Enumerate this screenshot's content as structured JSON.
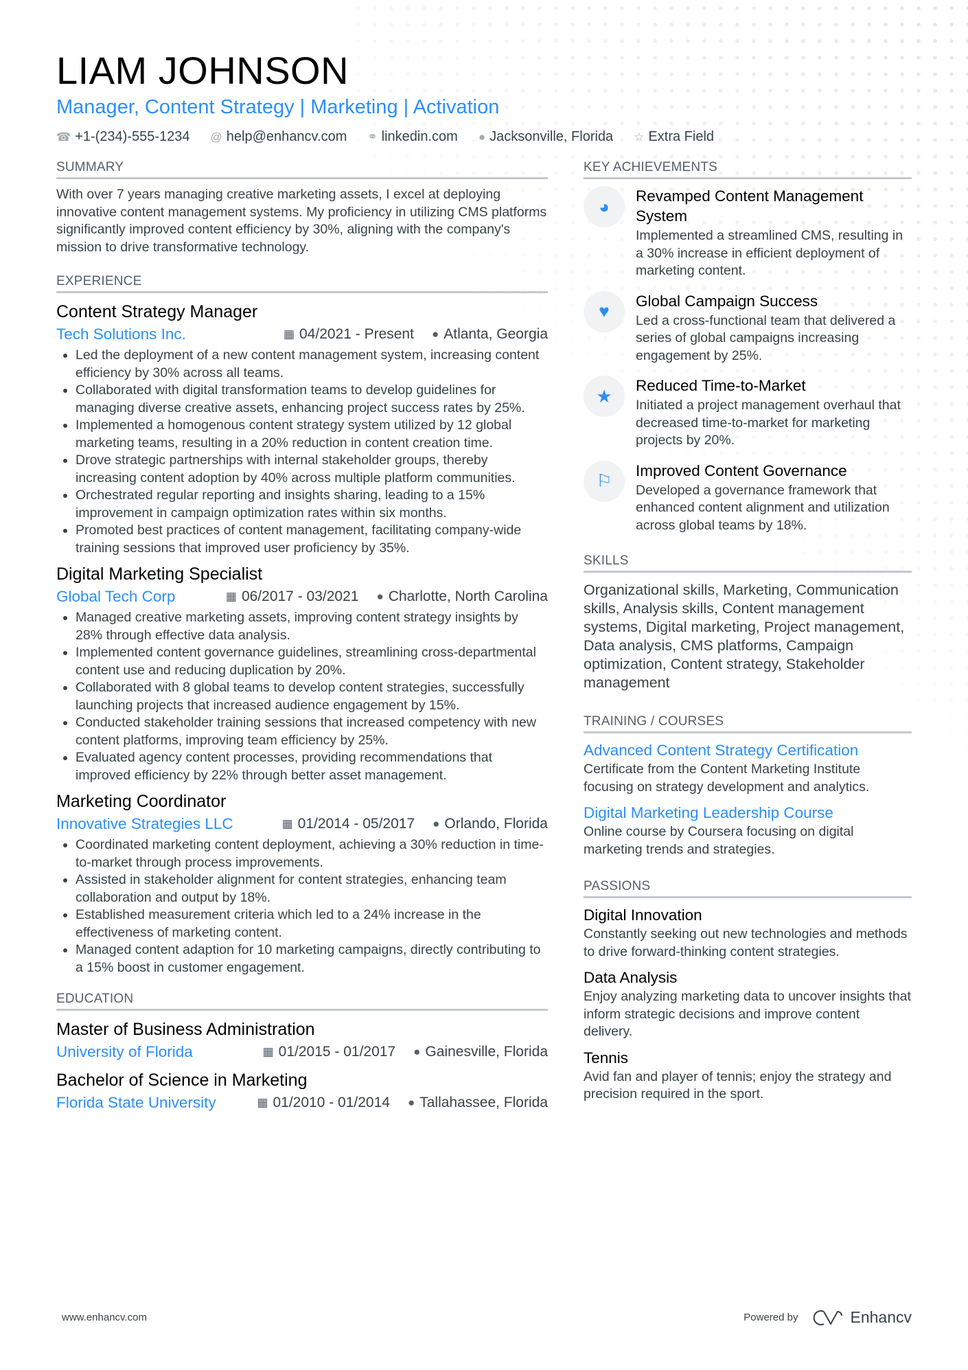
{
  "header": {
    "name": "LIAM JOHNSON",
    "title": "Manager, Content Strategy | Marketing | Activation",
    "contacts": [
      {
        "icon": "phone-icon",
        "glyph": "☎",
        "text": "+1-(234)-555-1234"
      },
      {
        "icon": "at-icon",
        "glyph": "@",
        "text": "help@enhancv.com"
      },
      {
        "icon": "link-icon",
        "glyph": "⚭",
        "text": "linkedin.com"
      },
      {
        "icon": "location-icon",
        "glyph": "●",
        "text": "Jacksonville, Florida"
      },
      {
        "icon": "star-icon",
        "glyph": "☆",
        "text": "Extra Field"
      }
    ]
  },
  "summary": {
    "heading": "SUMMARY",
    "text": "With over 7 years managing creative marketing assets, I excel at deploying innovative content management systems. My proficiency in utilizing CMS platforms significantly improved content efficiency by 30%, aligning with the company's mission to drive transformative technology."
  },
  "experience": {
    "heading": "EXPERIENCE",
    "jobs": [
      {
        "title": "Content Strategy Manager",
        "company": "Tech Solutions Inc.",
        "dates": "04/2021 - Present",
        "location": "Atlanta, Georgia",
        "bullets": [
          "Led the deployment of a new content management system, increasing content efficiency by 30% across all teams.",
          "Collaborated with digital transformation teams to develop guidelines for managing diverse creative assets, enhancing project success rates by 25%.",
          "Implemented a homogenous content strategy system utilized by 12 global marketing teams, resulting in a 20% reduction in content creation time.",
          "Drove strategic partnerships with internal stakeholder groups, thereby increasing content adoption by 40% across multiple platform communities.",
          "Orchestrated regular reporting and insights sharing, leading to a 15% improvement in campaign optimization rates within six months.",
          "Promoted best practices of content management, facilitating company-wide training sessions that improved user proficiency by 35%."
        ]
      },
      {
        "title": "Digital Marketing Specialist",
        "company": "Global Tech Corp",
        "dates": "06/2017 - 03/2021",
        "location": "Charlotte, North Carolina",
        "bullets": [
          "Managed creative marketing assets, improving content strategy insights by 28% through effective data analysis.",
          "Implemented content governance guidelines, streamlining cross-departmental content use and reducing duplication by 20%.",
          "Collaborated with 8 global teams to develop content strategies, successfully launching projects that increased audience engagement by 15%.",
          "Conducted stakeholder training sessions that increased competency with new content platforms, improving team efficiency by 25%.",
          "Evaluated agency content processes, providing recommendations that improved efficiency by 22% through better asset management."
        ]
      },
      {
        "title": "Marketing Coordinator",
        "company": "Innovative Strategies LLC",
        "dates": "01/2014 - 05/2017",
        "location": "Orlando, Florida",
        "bullets": [
          "Coordinated marketing content deployment, achieving a 30% reduction in time-to-market through process improvements.",
          "Assisted in stakeholder alignment for content strategies, enhancing team collaboration and output by 18%.",
          "Established measurement criteria which led to a 24% increase in the effectiveness of marketing content.",
          "Managed content adaption for 10 marketing campaigns, directly contributing to a 15% boost in customer engagement."
        ]
      }
    ]
  },
  "education": {
    "heading": "EDUCATION",
    "items": [
      {
        "degree": "Master of Business Administration",
        "school": "University of Florida",
        "dates": "01/2015 - 01/2017",
        "location": "Gainesville, Florida"
      },
      {
        "degree": "Bachelor of Science in Marketing",
        "school": "Florida State University",
        "dates": "01/2010 - 01/2014",
        "location": "Tallahassee, Florida"
      }
    ]
  },
  "achievements": {
    "heading": "KEY ACHIEVEMENTS",
    "items": [
      {
        "icon": "brain-head-icon",
        "glyph": "◕",
        "title": "Revamped Content Management System",
        "desc": "Implemented a streamlined CMS, resulting in a 30% increase in efficient deployment of marketing content."
      },
      {
        "icon": "heart-icon",
        "glyph": "♥",
        "title": "Global Campaign Success",
        "desc": "Led a cross-functional team that delivered a series of global campaigns increasing engagement by 25%."
      },
      {
        "icon": "star-icon",
        "glyph": "★",
        "title": "Reduced Time-to-Market",
        "desc": "Initiated a project management overhaul that decreased time-to-market for marketing projects by 20%."
      },
      {
        "icon": "flag-icon",
        "glyph": "⚐",
        "title": "Improved Content Governance",
        "desc": "Developed a governance framework that enhanced content alignment and utilization across global teams by 18%."
      }
    ]
  },
  "skills": {
    "heading": "SKILLS",
    "text": "Organizational skills, Marketing, Communication skills, Analysis skills, Content management systems, Digital marketing, Project management, Data analysis, CMS platforms, Campaign optimization, Content strategy, Stakeholder management"
  },
  "training": {
    "heading": "TRAINING / COURSES",
    "items": [
      {
        "title": "Advanced Content Strategy Certification",
        "desc": "Certificate from the Content Marketing Institute focusing on strategy development and analytics."
      },
      {
        "title": "Digital Marketing Leadership Course",
        "desc": "Online course by Coursera focusing on digital marketing trends and strategies."
      }
    ]
  },
  "passions": {
    "heading": "PASSIONS",
    "items": [
      {
        "title": "Digital Innovation",
        "desc": "Constantly seeking out new technologies and methods to drive forward-thinking content strategies."
      },
      {
        "title": "Data Analysis",
        "desc": "Enjoy analyzing marketing data to uncover insights that inform strategic decisions and improve content delivery."
      },
      {
        "title": "Tennis",
        "desc": "Avid fan and player of tennis; enjoy the strategy and precision required in the sport."
      }
    ]
  },
  "footer": {
    "website": "www.enhancv.com",
    "powered_by": "Powered by",
    "brand": "Enhancv"
  },
  "icons": {
    "calendar": "▦",
    "location": "●"
  },
  "colors": {
    "accent": "#2b8ff7",
    "text": "#384347",
    "heading": "#000000"
  }
}
